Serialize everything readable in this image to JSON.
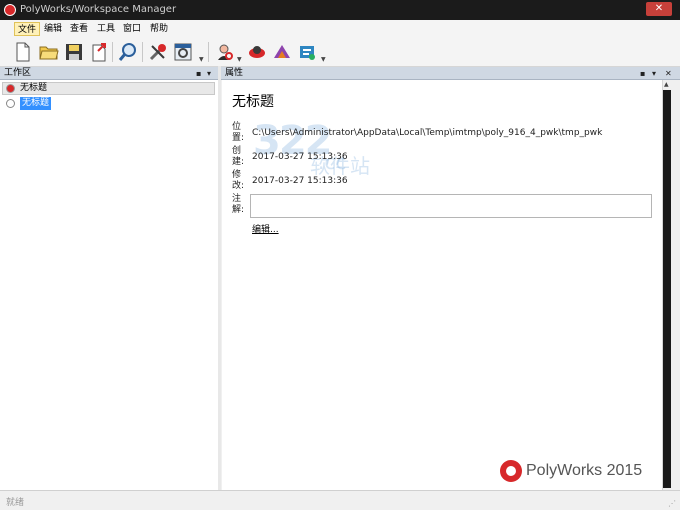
{
  "window": {
    "title": "PolyWorks/Workspace Manager",
    "close_glyph": "✕"
  },
  "menu": [
    {
      "label": "文件",
      "active": true
    },
    {
      "label": "编辑"
    },
    {
      "label": "查看"
    },
    {
      "label": "工具"
    },
    {
      "label": "窗口"
    },
    {
      "label": "帮助"
    }
  ],
  "toolbar": {
    "buttons": [
      {
        "name": "new-icon"
      },
      {
        "name": "open-folder-icon"
      },
      {
        "name": "save-icon"
      },
      {
        "name": "export-icon"
      },
      {
        "name": "search-icon"
      },
      {
        "name": "tools-icon"
      },
      {
        "name": "settings-icon"
      },
      {
        "name": "inspector-icon"
      },
      {
        "name": "modeler-icon"
      },
      {
        "name": "talisman-icon"
      },
      {
        "name": "script-icon"
      }
    ]
  },
  "left_panel": {
    "header": "工作区",
    "root_label": "无标题",
    "item_label": "无标题"
  },
  "right_panel": {
    "header": "属性",
    "title": "无标题",
    "labels": {
      "location": "位置:",
      "created": "创建:",
      "modified": "修改:",
      "notes": "注解:"
    },
    "location": "C:\\Users\\Administrator\\AppData\\Local\\Temp\\imtmp\\poly_916_4_pwk\\tmp_pwk",
    "created": "2017-03-27 15:13:36",
    "modified": "2017-03-27 15:13:36",
    "edit_link": "编辑..."
  },
  "watermark": {
    "main": "322",
    "sub": "软件站",
    "domain": ".cc"
  },
  "logo": {
    "text": "PolyWorks 2015"
  },
  "panel_controls": {
    "pin": "▪",
    "dropdown": "▾",
    "close": "✕"
  },
  "status": {
    "text": "就绪"
  }
}
